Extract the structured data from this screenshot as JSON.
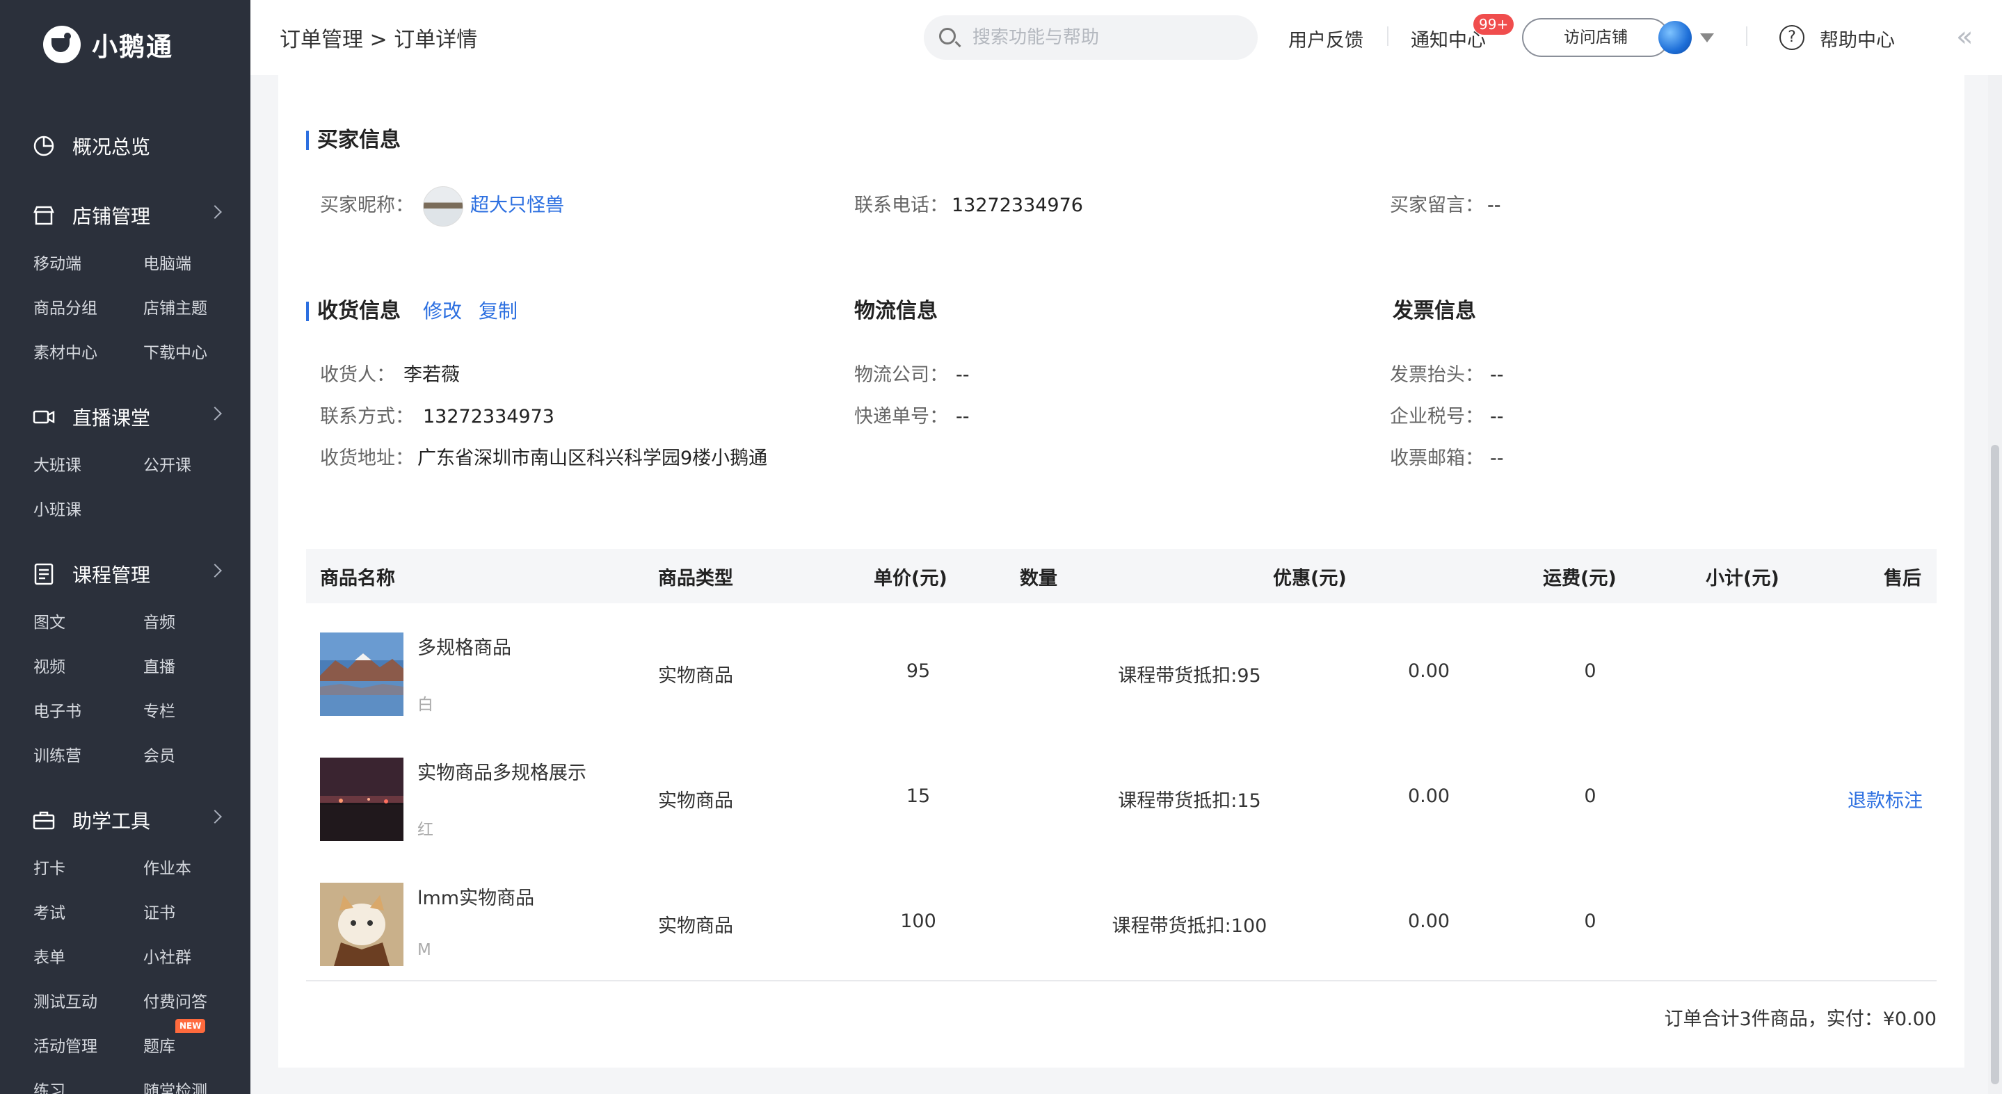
{
  "app": {
    "name": "小鹅通"
  },
  "sidebar": {
    "overview": "概况总览",
    "groups": [
      {
        "title": "店铺管理",
        "items": [
          "移动端",
          "电脑端",
          "商品分组",
          "店铺主题",
          "素材中心",
          "下载中心"
        ]
      },
      {
        "title": "直播课堂",
        "items": [
          "大班课",
          "公开课",
          "小班课"
        ]
      },
      {
        "title": "课程管理",
        "items": [
          "图文",
          "音频",
          "视频",
          "直播",
          "电子书",
          "专栏",
          "训练营",
          "会员"
        ]
      },
      {
        "title": "助学工具",
        "items": [
          "打卡",
          "作业本",
          "考试",
          "证书",
          "表单",
          "小社群",
          "测试互动",
          "付费问答",
          "活动管理",
          "题库",
          "练习",
          "随堂检测"
        ]
      }
    ],
    "new_badge": "NEW"
  },
  "topbar": {
    "breadcrumb": "订单管理 > 订单详情",
    "search_placeholder": "搜索功能与帮助",
    "feedback": "用户反馈",
    "notifications": "通知中心",
    "notifications_count": "99+",
    "visit_store": "访问店铺",
    "help_center": "帮助中心",
    "help_icon_glyph": "?",
    "collapse_glyph": "«"
  },
  "buyer": {
    "section": "买家信息",
    "nickname_label": "买家昵称：",
    "nickname": "超大只怪兽",
    "phone_label": "联系电话：",
    "phone": "13272334976",
    "message_label": "买家留言：",
    "message": "--"
  },
  "shipping": {
    "section": "收货信息",
    "edit": "修改",
    "copy": "复制",
    "receiver_label": "收货人：",
    "receiver": "李若薇",
    "contact_label": "联系方式：",
    "contact": "13272334973",
    "address_label": "收货地址：",
    "address": "广东省深圳市南山区科兴科学园9楼小鹅通"
  },
  "logistics": {
    "section": "物流信息",
    "company_label": "物流公司：",
    "company": "--",
    "tracking_label": "快递单号：",
    "tracking": "--"
  },
  "invoice": {
    "section": "发票信息",
    "title_label": "发票抬头：",
    "title": "--",
    "tax_label": "企业税号：",
    "tax": "--",
    "email_label": "收票邮箱：",
    "email": "--"
  },
  "table": {
    "headers": [
      "商品名称",
      "商品类型",
      "单价(元)",
      "数量",
      "优惠(元)",
      "运费(元)",
      "小计(元)",
      "售后"
    ],
    "rows": [
      {
        "name": "多规格商品",
        "spec": "白",
        "type": "实物商品",
        "price": "95",
        "discount": "课程带货抵扣:95",
        "shipping": "0.00",
        "subtotal": "0",
        "after_sale": ""
      },
      {
        "name": "实物商品多规格展示",
        "spec": "红",
        "type": "实物商品",
        "price": "15",
        "discount": "课程带货抵扣:15",
        "shipping": "0.00",
        "subtotal": "0",
        "after_sale": "退款标注"
      },
      {
        "name": "lmm实物商品",
        "spec": "M",
        "type": "实物商品",
        "price": "100",
        "discount": "课程带货抵扣:100",
        "shipping": "0.00",
        "subtotal": "0",
        "after_sale": ""
      }
    ],
    "total": "订单合计3件商品，实付：¥0.00"
  },
  "colors": {
    "sidebar_bg": "#2b303b",
    "accent": "#2c6fe0",
    "badge": "#f04d4d",
    "new_badge": "#ff6a3d"
  }
}
